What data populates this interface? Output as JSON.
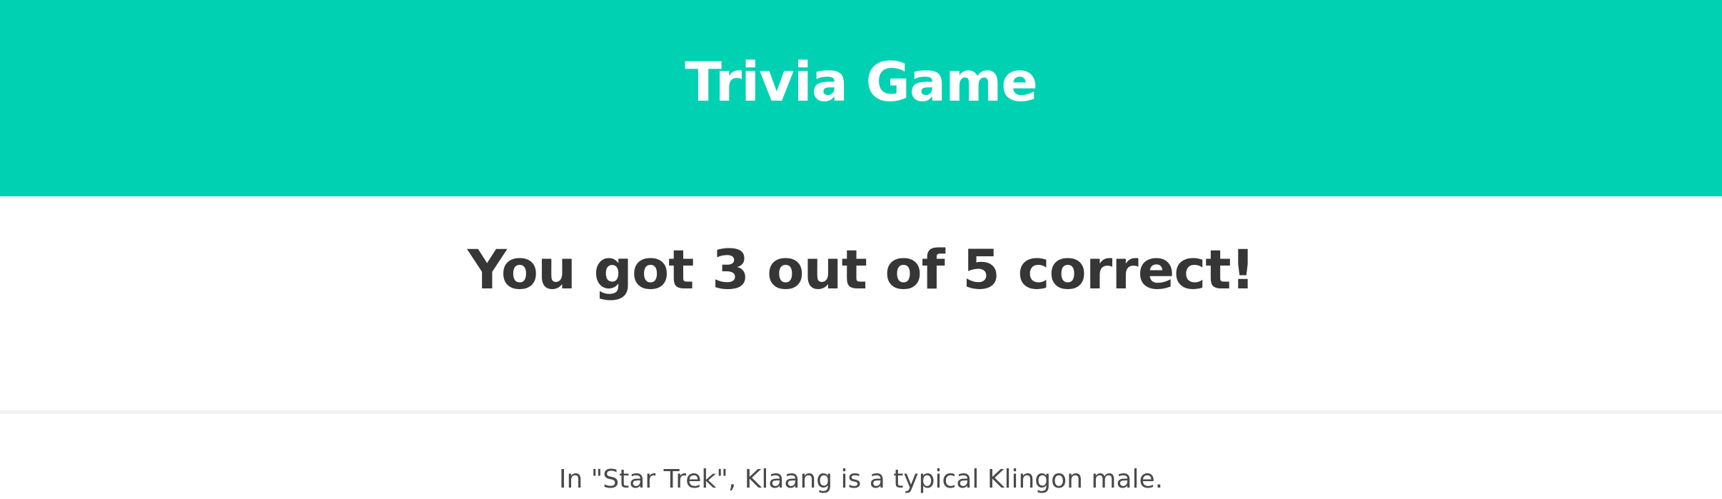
{
  "header": {
    "title": "Trivia Game"
  },
  "results": {
    "score_text": "You got 3 out of 5 correct!"
  },
  "question": {
    "text": "In \"Star Trek\", Klaang is a typical Klingon male."
  },
  "colors": {
    "header_background": "#00d1b2",
    "header_text": "#ffffff",
    "body_text": "#363636",
    "divider": "#f2f2f2"
  }
}
